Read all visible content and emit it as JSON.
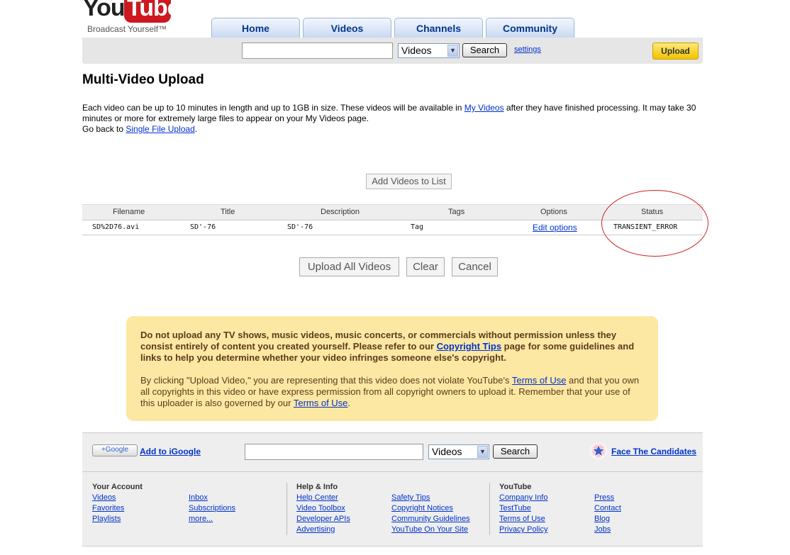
{
  "header": {
    "logo_you": "You",
    "logo_tube": "Tube",
    "tagline": "Broadcast Yourself™",
    "tabs": [
      "Home",
      "Videos",
      "Channels",
      "Community"
    ],
    "search_value": "",
    "search_scope": "Videos",
    "search_button": "Search",
    "settings_link": "settings",
    "upload_button": "Upload"
  },
  "page": {
    "title": "Multi-Video Upload",
    "intro_part1": "Each video can be up to 10 minutes in length and up to 1GB in size. These videos will be available in ",
    "intro_link_myvideos": "My Videos",
    "intro_part2": " after they have finished processing. It may take 30 minutes or more for extremely large files to appear on your My Videos page.",
    "goback_prefix": "Go back to ",
    "goback_link": "Single File Upload",
    "goback_suffix": ".",
    "add_videos_button": "Add Videos to List"
  },
  "table": {
    "headers": [
      "Filename",
      "Title",
      "Description",
      "Tags",
      "Options",
      "Status"
    ],
    "rows": [
      {
        "filename": "SD%2D76.avi",
        "title": "SD'-76",
        "description": "SD'-76",
        "tags": "Tag",
        "options": "Edit options",
        "status": "TRANSIENT_ERROR"
      }
    ]
  },
  "actions": {
    "upload_all": "Upload All Videos",
    "clear": "Clear",
    "cancel": "Cancel"
  },
  "notice": {
    "bold_part1": "Do not upload any TV shows, music videos, music concerts, or commercials without permission unless they consist entirely of content you created yourself. Please refer to our ",
    "bold_link": "Copyright Tips",
    "bold_part2": " page for some guidelines and links to help you determine whether your video infringes someone else's copyright.",
    "p2_part1": "By clicking \"Upload Video,\" you are representing that this video does not violate YouTube's ",
    "p2_link1": "Terms of Use",
    "p2_part2": " and that you own all copyrights in this video or have express permission from all copyright owners to upload it. Remember that your use of this uploader is also governed by our ",
    "p2_link2": "Terms of Use",
    "p2_part3": "."
  },
  "footer": {
    "google_badge": "+Google",
    "add_igoogle": "Add to iGoogle",
    "search_value": "",
    "search_scope": "Videos",
    "search_button": "Search",
    "face_candidates": "Face The Candidates",
    "your_account": {
      "heading": "Your Account",
      "col1": [
        "Videos",
        "Favorites",
        "Playlists"
      ],
      "col2": [
        "Inbox",
        "Subscriptions",
        "more..."
      ]
    },
    "help_info": {
      "heading": "Help & Info",
      "col1": [
        "Help Center",
        "Video Toolbox",
        "Developer APIs",
        "Advertising"
      ],
      "col2": [
        "Safety Tips",
        "Copyright Notices",
        "Community Guidelines",
        "YouTube On Your Site"
      ]
    },
    "youtube": {
      "heading": "YouTube",
      "col1": [
        "Company Info",
        "TestTube",
        "Terms of Use",
        "Privacy Policy"
      ],
      "col2": [
        "Press",
        "Contact",
        "Blog",
        "Jobs"
      ]
    }
  },
  "colors": {
    "link": "#0033cc",
    "brand_red": "#cc181e",
    "notice_bg": "#fde8a3",
    "annotation_circle": "#d42020"
  }
}
